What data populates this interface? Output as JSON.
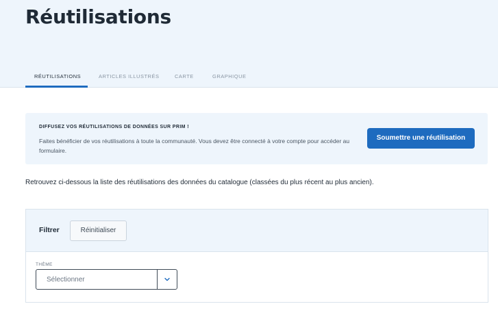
{
  "header": {
    "title": "Réutilisations",
    "tabs": [
      {
        "label": "RÉUTILISATIONS",
        "active": true
      },
      {
        "label": "ARTICLES ILLUSTRÉS",
        "active": false
      },
      {
        "label": "CARTE",
        "active": false
      },
      {
        "label": "GRAPHIQUE",
        "active": false
      }
    ]
  },
  "info_box": {
    "heading": "DIFFUSEZ VOS RÉUTILISATIONS DE DONNÉES SUR PRIM !",
    "text": "Faites bénéficier de vos réutilisations à toute la communauté. Vous devez être connecté à votre compte pour accéder au formulaire.",
    "button_label": "Soumettre une réutilisation"
  },
  "intro_text": "Retrouvez ci-dessous la liste des réutilisations des données du catalogue (classées du plus récent au plus ancien).",
  "filters": {
    "title": "Filtrer",
    "reset_label": "Réinitialiser",
    "theme_label": "THÈME",
    "theme_value": "Sélectionner"
  },
  "colors": {
    "accent": "#1e6bbf",
    "header_bg": "#eef5fc",
    "text": "#1f2a36"
  }
}
